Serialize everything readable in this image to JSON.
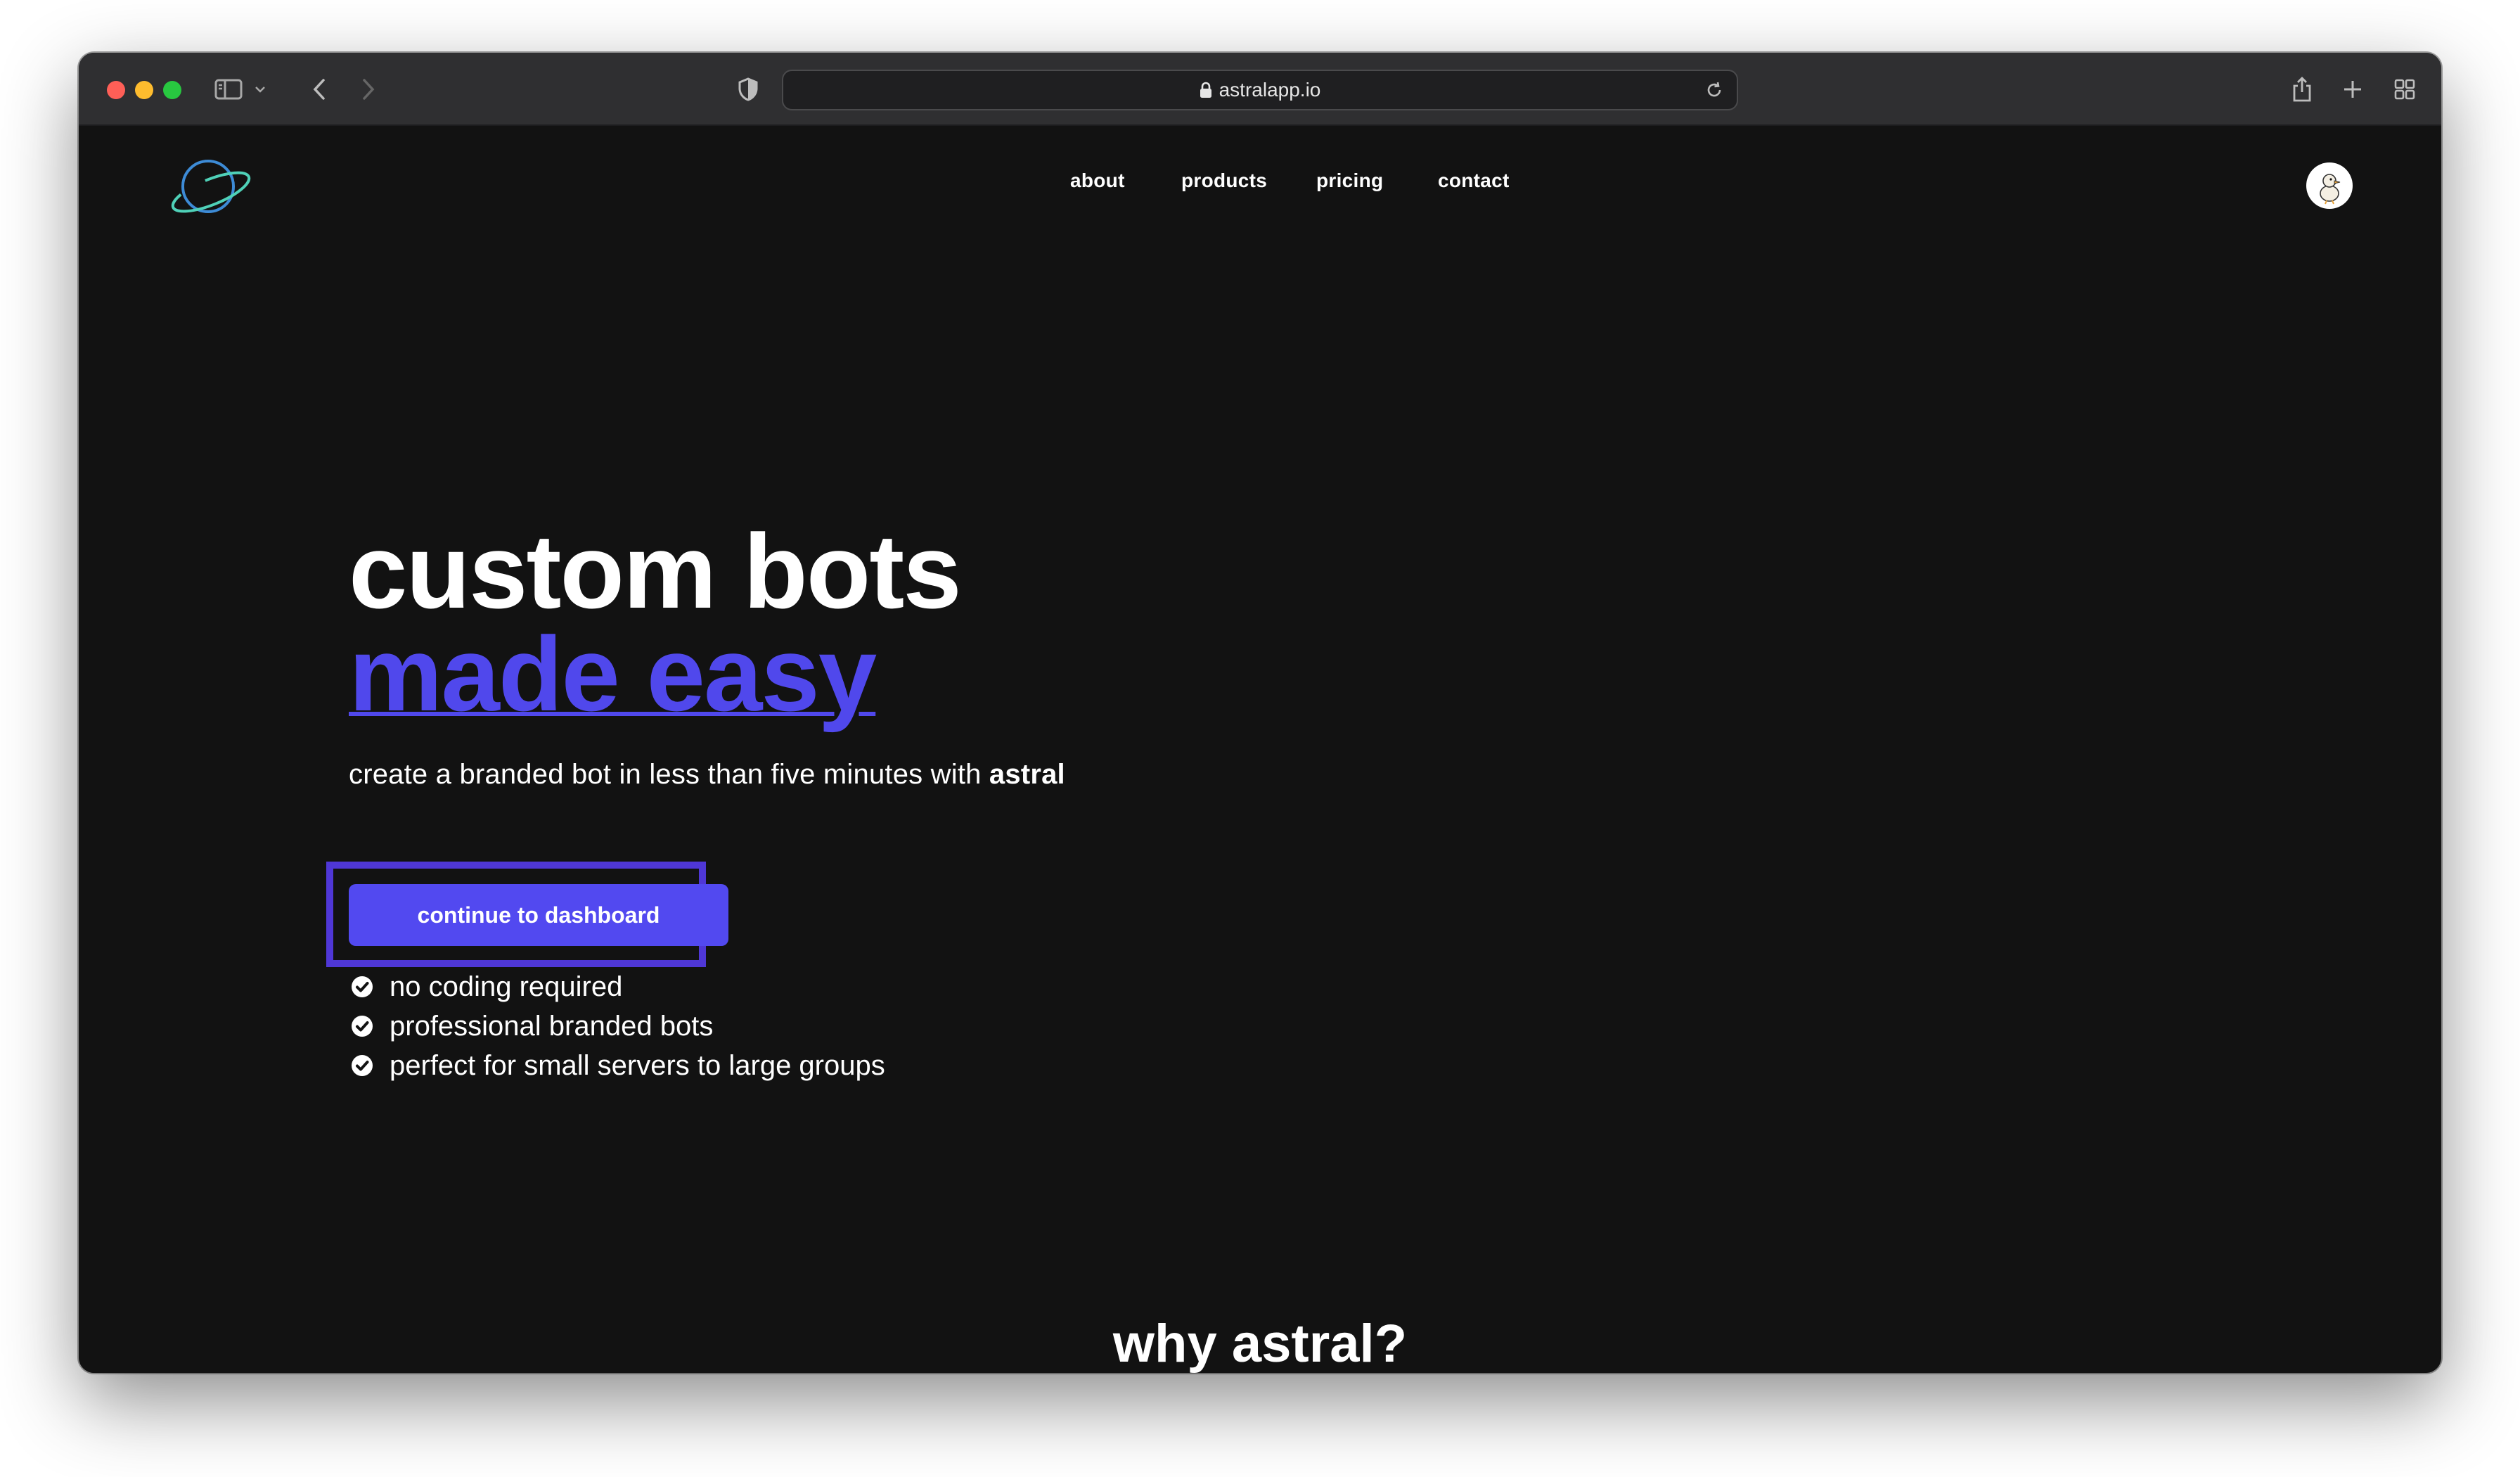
{
  "browser": {
    "url": "astralapp.io",
    "buttons": {
      "sidebar": "sidebar-toggle",
      "back": "back",
      "forward": "forward",
      "share": "share",
      "new_tab": "new-tab",
      "tabs": "tab-overview"
    }
  },
  "nav": {
    "items": [
      {
        "label": "about"
      },
      {
        "label": "products"
      },
      {
        "label": "pricing"
      },
      {
        "label": "contact"
      }
    ]
  },
  "hero": {
    "title_line1": "custom bots",
    "title_line2": "made easy",
    "subtitle_prefix": "create a branded bot in less than five minutes with ",
    "subtitle_brand": "astral",
    "cta_label": "continue to dashboard",
    "features": [
      "no coding required",
      "professional branded bots",
      "perfect for small servers to large groups"
    ]
  },
  "section": {
    "next_heading": "why astral?"
  },
  "colors": {
    "background": "#121212",
    "accent": "#5048ec",
    "button": "#5249f0",
    "highlight_outline": "#4f37d6",
    "text": "#ffffff",
    "logo_planet": "#3d8bd6",
    "logo_ring": "#4fd1b8"
  },
  "icons": {
    "logo": "planet-logo-icon",
    "lock": "lock-icon",
    "reload": "reload-icon",
    "shield": "privacy-shield-icon",
    "check": "check-circle-icon",
    "avatar": "duck-avatar"
  }
}
